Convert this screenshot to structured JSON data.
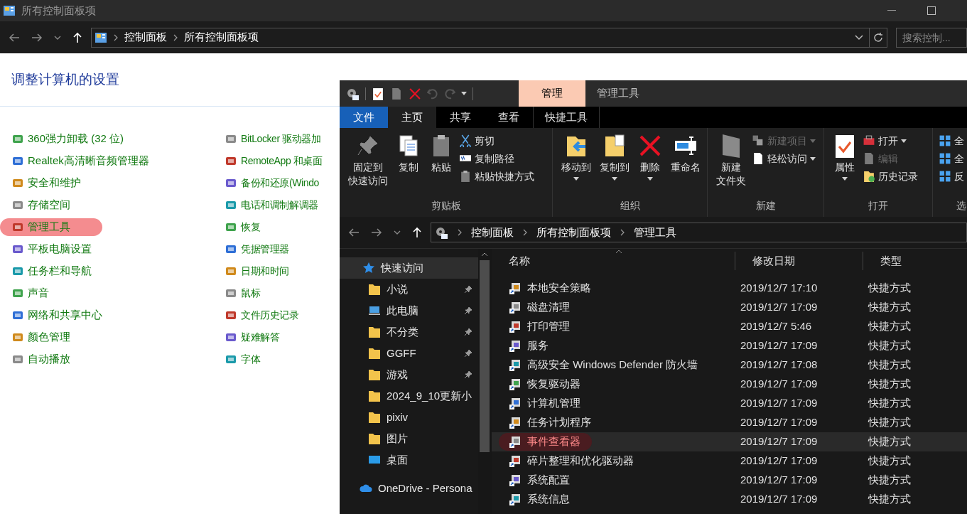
{
  "cp_window": {
    "title": "所有控制面板项",
    "breadcrumb": [
      "控制面板",
      "所有控制面板项"
    ],
    "search_placeholder": "搜索控制...",
    "heading": "调整计算机的设置",
    "items_left": [
      {
        "label": "360强力卸载 (32 位)",
        "highlighted": false
      },
      {
        "label": "Realtek高清晰音频管理器",
        "highlighted": false
      },
      {
        "label": "安全和维护",
        "highlighted": false
      },
      {
        "label": "存储空间",
        "highlighted": false
      },
      {
        "label": "管理工具",
        "highlighted": true
      },
      {
        "label": "平板电脑设置",
        "highlighted": false
      },
      {
        "label": "任务栏和导航",
        "highlighted": false
      },
      {
        "label": "声音",
        "highlighted": false
      },
      {
        "label": "网络和共享中心",
        "highlighted": false
      },
      {
        "label": "颜色管理",
        "highlighted": false
      },
      {
        "label": "自动播放",
        "highlighted": false
      }
    ],
    "items_right": [
      {
        "label": "BitLocker 驱动器加",
        "highlighted": false
      },
      {
        "label": "RemoteApp 和桌面",
        "highlighted": false
      },
      {
        "label": "备份和还原(Windo",
        "highlighted": false
      },
      {
        "label": "电话和调制解调器",
        "highlighted": false
      },
      {
        "label": "恢复",
        "highlighted": false
      },
      {
        "label": "凭据管理器",
        "highlighted": false
      },
      {
        "label": "日期和时间",
        "highlighted": false
      },
      {
        "label": "鼠标",
        "highlighted": false
      },
      {
        "label": "文件历史记录",
        "highlighted": false
      },
      {
        "label": "疑难解答",
        "highlighted": false
      },
      {
        "label": "字体",
        "highlighted": false
      }
    ]
  },
  "explorer": {
    "context_tab": "管理",
    "title": "管理工具",
    "ribbon_tabs": [
      {
        "label": "文件",
        "kind": "file",
        "selected": false
      },
      {
        "label": "主页",
        "kind": "tab",
        "selected": true
      },
      {
        "label": "共享",
        "kind": "tab",
        "selected": false
      },
      {
        "label": "查看",
        "kind": "tab",
        "selected": false
      },
      {
        "label": "快捷工具",
        "kind": "tab",
        "selected": false
      }
    ],
    "ribbon_groups": [
      {
        "label": "剪贴板",
        "buttons": [
          {
            "label": [
              "固定到",
              "快速访问"
            ],
            "kind": "large",
            "disabled": false,
            "dropdown": false
          },
          {
            "label": [
              "复制"
            ],
            "kind": "large",
            "disabled": false,
            "dropdown": false
          },
          {
            "label": [
              "粘贴"
            ],
            "kind": "large",
            "disabled": false,
            "dropdown": false
          },
          {
            "label": [
              "剪切"
            ],
            "kind": "small",
            "disabled": false,
            "dropdown": false
          },
          {
            "label": [
              "复制路径"
            ],
            "kind": "small",
            "disabled": false,
            "dropdown": false
          },
          {
            "label": [
              "粘贴快捷方式"
            ],
            "kind": "small",
            "disabled": false,
            "dropdown": false
          }
        ]
      },
      {
        "label": "组织",
        "buttons": [
          {
            "label": [
              "移动到"
            ],
            "kind": "large",
            "disabled": false,
            "dropdown": true
          },
          {
            "label": [
              "复制到"
            ],
            "kind": "large",
            "disabled": false,
            "dropdown": true
          },
          {
            "label": [
              "删除"
            ],
            "kind": "large",
            "disabled": false,
            "dropdown": true
          },
          {
            "label": [
              "重命名"
            ],
            "kind": "large",
            "disabled": false,
            "dropdown": false
          }
        ]
      },
      {
        "label": "新建",
        "buttons": [
          {
            "label": [
              "新建",
              "文件夹"
            ],
            "kind": "large",
            "disabled": false,
            "dropdown": false
          },
          {
            "label": [
              "新建项目"
            ],
            "kind": "small",
            "disabled": true,
            "dropdown": true
          },
          {
            "label": [
              "轻松访问"
            ],
            "kind": "small",
            "disabled": false,
            "dropdown": true
          }
        ]
      },
      {
        "label": "打开",
        "buttons": [
          {
            "label": [
              "属性"
            ],
            "kind": "large",
            "disabled": false,
            "dropdown": true
          },
          {
            "label": [
              "打开"
            ],
            "kind": "small",
            "disabled": false,
            "dropdown": true
          },
          {
            "label": [
              "编辑"
            ],
            "kind": "small",
            "disabled": true,
            "dropdown": false
          },
          {
            "label": [
              "历史记录"
            ],
            "kind": "small",
            "disabled": false,
            "dropdown": false
          }
        ]
      },
      {
        "label": "选",
        "buttons": [
          {
            "label": [
              "全"
            ],
            "kind": "small",
            "disabled": false,
            "dropdown": false
          },
          {
            "label": [
              "全"
            ],
            "kind": "small",
            "disabled": false,
            "dropdown": false
          },
          {
            "label": [
              "反"
            ],
            "kind": "small",
            "disabled": false,
            "dropdown": false
          }
        ]
      }
    ],
    "breadcrumb": [
      "控制面板",
      "所有控制面板项",
      "管理工具"
    ],
    "nav": [
      {
        "label": "快速访问",
        "kind": "star",
        "pinned": false,
        "selected": true
      },
      {
        "label": "小说",
        "kind": "folder",
        "pinned": true,
        "selected": false
      },
      {
        "label": "此电脑",
        "kind": "pc",
        "pinned": true,
        "selected": false
      },
      {
        "label": "不分类",
        "kind": "folder",
        "pinned": true,
        "selected": false
      },
      {
        "label": "GGFF",
        "kind": "folder",
        "pinned": true,
        "selected": false
      },
      {
        "label": "游戏",
        "kind": "folder",
        "pinned": true,
        "selected": false
      },
      {
        "label": "2024_9_10更新小",
        "kind": "folder",
        "pinned": false,
        "selected": false
      },
      {
        "label": "pixiv",
        "kind": "folder",
        "pinned": false,
        "selected": false
      },
      {
        "label": "图片",
        "kind": "folder",
        "pinned": false,
        "selected": false
      },
      {
        "label": "桌面",
        "kind": "desktop",
        "pinned": false,
        "selected": false
      },
      {
        "label": "OneDrive - Persona",
        "kind": "cloud",
        "pinned": false,
        "selected": false
      }
    ],
    "columns": [
      "名称",
      "修改日期",
      "类型"
    ],
    "rows": [
      {
        "name": "本地安全策略",
        "date": "2019/12/7 17:10",
        "type": "快捷方式",
        "selected": false,
        "highlighted": false
      },
      {
        "name": "磁盘清理",
        "date": "2019/12/7 17:09",
        "type": "快捷方式",
        "selected": false,
        "highlighted": false
      },
      {
        "name": "打印管理",
        "date": "2019/12/7 5:46",
        "type": "快捷方式",
        "selected": false,
        "highlighted": false
      },
      {
        "name": "服务",
        "date": "2019/12/7 17:09",
        "type": "快捷方式",
        "selected": false,
        "highlighted": false
      },
      {
        "name": "高级安全 Windows Defender 防火墙",
        "date": "2019/12/7 17:08",
        "type": "快捷方式",
        "selected": false,
        "highlighted": false
      },
      {
        "name": "恢复驱动器",
        "date": "2019/12/7 17:09",
        "type": "快捷方式",
        "selected": false,
        "highlighted": false
      },
      {
        "name": "计算机管理",
        "date": "2019/12/7 17:09",
        "type": "快捷方式",
        "selected": false,
        "highlighted": false
      },
      {
        "name": "任务计划程序",
        "date": "2019/12/7 17:09",
        "type": "快捷方式",
        "selected": false,
        "highlighted": false
      },
      {
        "name": "事件查看器",
        "date": "2019/12/7 17:09",
        "type": "快捷方式",
        "selected": true,
        "highlighted": true
      },
      {
        "name": "碎片整理和优化驱动器",
        "date": "2019/12/7 17:09",
        "type": "快捷方式",
        "selected": false,
        "highlighted": false
      },
      {
        "name": "系统配置",
        "date": "2019/12/7 17:09",
        "type": "快捷方式",
        "selected": false,
        "highlighted": false
      },
      {
        "name": "系统信息",
        "date": "2019/12/7 17:09",
        "type": "快捷方式",
        "selected": false,
        "highlighted": false
      }
    ]
  }
}
